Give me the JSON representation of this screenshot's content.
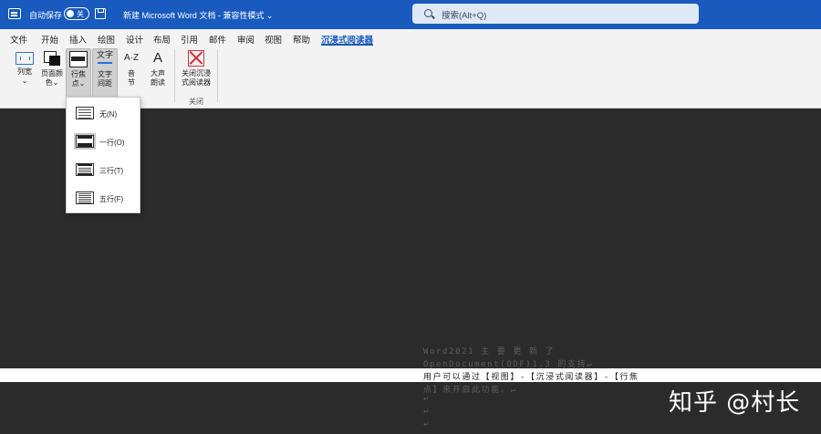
{
  "titlebar": {
    "autosave_label": "自动保存",
    "toggle_state": "关",
    "doc_title": "新建 Microsoft Word 文档 - 兼容性模式 ⌄",
    "search_placeholder": "搜索(Alt+Q)"
  },
  "menu_tabs": [
    {
      "label": "文件"
    },
    {
      "label": "开始"
    },
    {
      "label": "插入"
    },
    {
      "label": "绘图"
    },
    {
      "label": "设计"
    },
    {
      "label": "布局"
    },
    {
      "label": "引用"
    },
    {
      "label": "邮件"
    },
    {
      "label": "审阅"
    },
    {
      "label": "视图"
    },
    {
      "label": "帮助"
    },
    {
      "label": "沉浸式阅读器",
      "active": true
    }
  ],
  "ribbon": {
    "column_width": {
      "line1": "列宽",
      "line2": "⌄"
    },
    "page_color": {
      "line1": "页面颜",
      "line2": "色⌄"
    },
    "line_focus": {
      "line1": "行焦",
      "line2": "点⌄"
    },
    "text_spacing": {
      "icon_text": "文字",
      "line1": "文字",
      "line2": "间距"
    },
    "syllables": {
      "icon_text": "A·Z",
      "line1": "音",
      "line2": "节"
    },
    "read_aloud": {
      "icon_text": "A",
      "line1": "大声",
      "line2": "朗读"
    },
    "close_reader": {
      "line1": "关闭沉浸",
      "line2": "式阅读器"
    },
    "close_group_label": "关闭"
  },
  "line_focus_menu": [
    {
      "label": "无(N)",
      "selected": false
    },
    {
      "label": "一行(O)",
      "selected": true
    },
    {
      "label": "三行(T)",
      "selected": false
    },
    {
      "label": "五行(F)",
      "selected": false
    }
  ],
  "document": {
    "line1": "Word2021    主   要   更   新   了",
    "line2": "OpenDocument(ODF)1.3 的支持↵",
    "line3": "用户可以通过【视图】-【沉浸式阅读器】-【行焦",
    "line4": "点】来开启此功能。↵",
    "mark1": "↵",
    "mark2": "↵",
    "mark3": "↵"
  },
  "watermark": "知乎 @村长"
}
